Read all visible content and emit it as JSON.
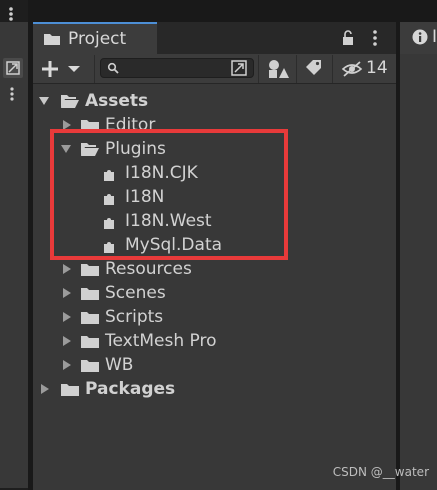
{
  "project_tab": {
    "title": "Project",
    "hidden_count": "14"
  },
  "tree": {
    "assets": "Assets",
    "editor": "Editor",
    "plugins": "Plugins",
    "plugin_items": [
      "I18N.CJK",
      "I18N",
      "I18N.West",
      "MySql.Data"
    ],
    "resources": "Resources",
    "scenes": "Scenes",
    "scripts": "Scripts",
    "textmesh": "TextMesh Pro",
    "wb": "WB",
    "packages": "Packages"
  },
  "watermark": "CSDN @__water",
  "colors": {
    "highlight": "#e83a3a",
    "tab_accent": "#4d8fd6",
    "panel_bg": "#383838"
  }
}
